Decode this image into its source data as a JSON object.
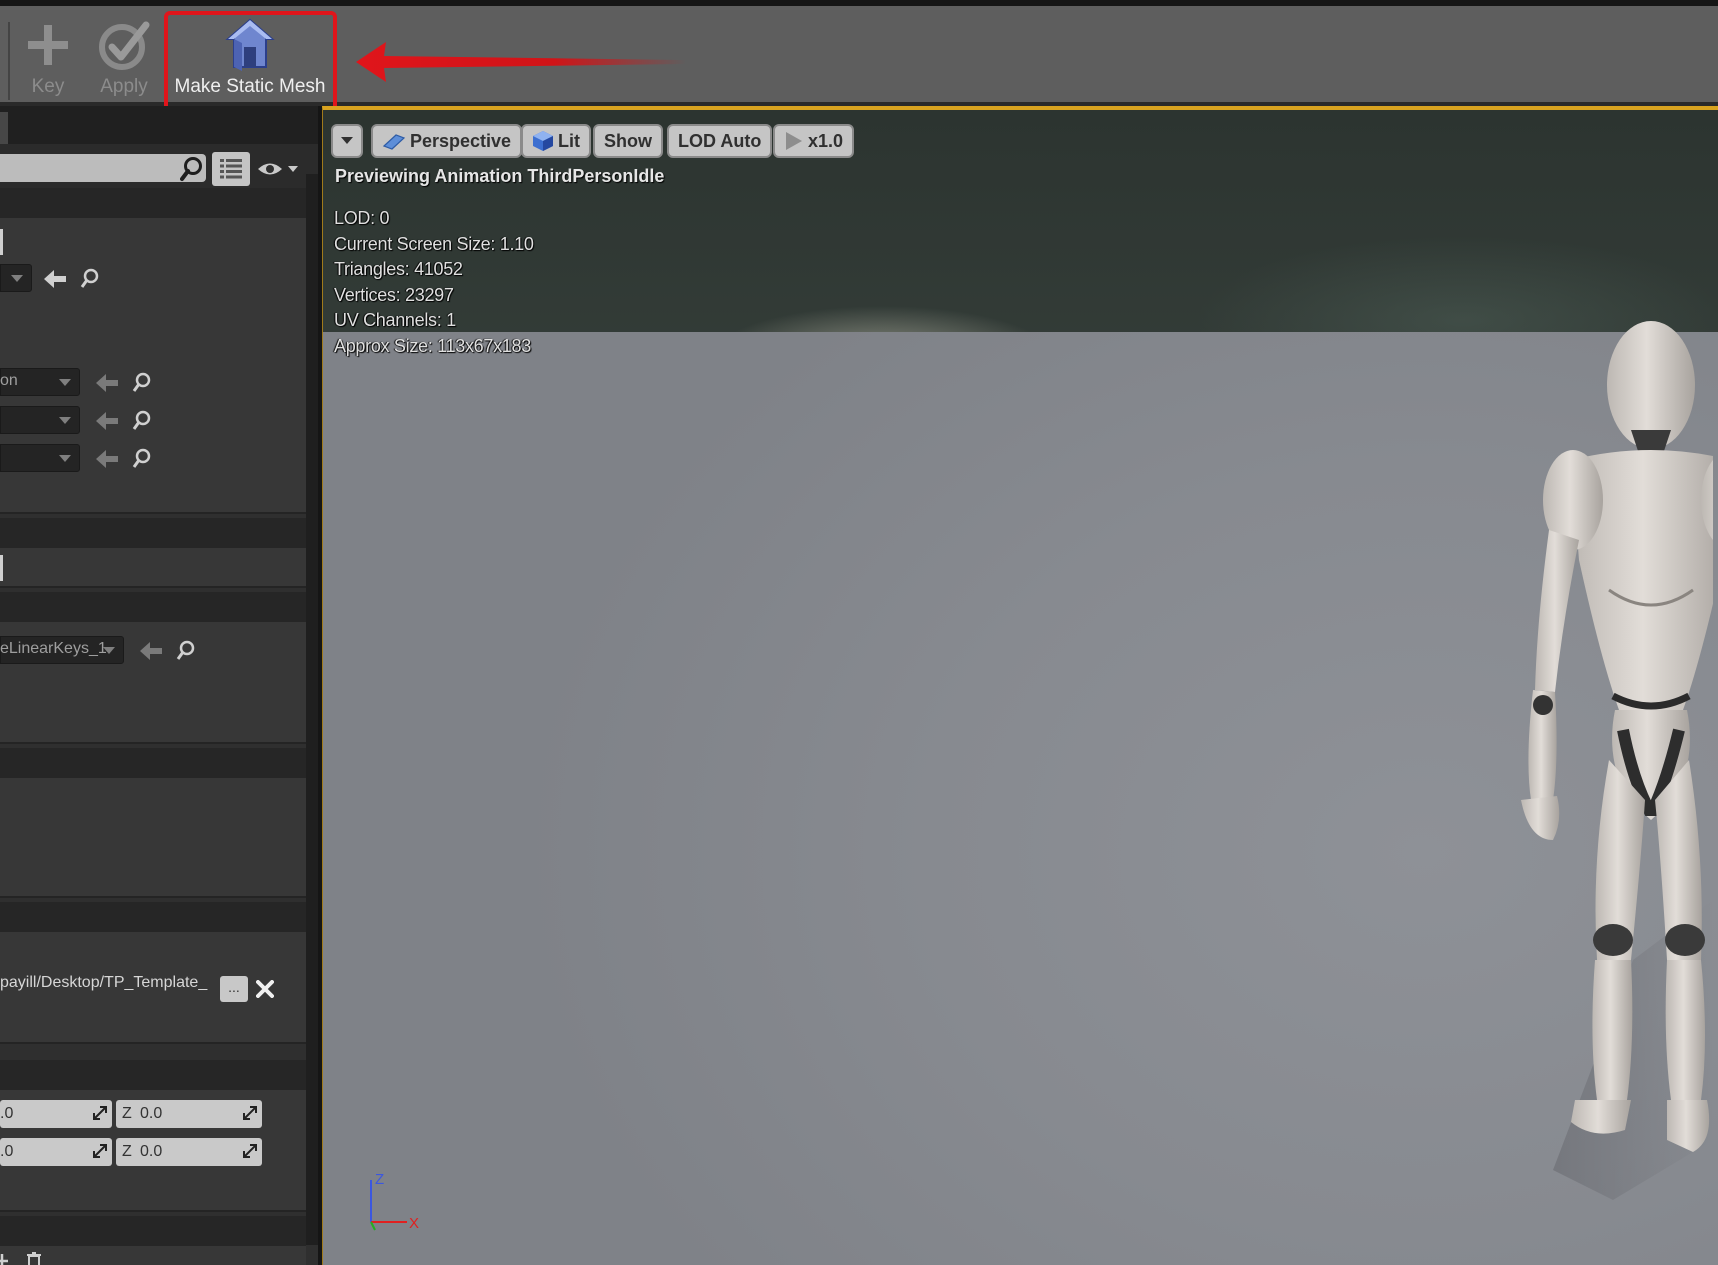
{
  "toolbar": {
    "buttons": [
      {
        "icon": "plus-icon",
        "label": "Key",
        "enabled": false
      },
      {
        "icon": "apply-icon",
        "label": "Apply",
        "enabled": false
      },
      {
        "icon": "static-mesh-icon",
        "label": "Make Static Mesh",
        "enabled": true
      }
    ],
    "highlight_color": "#e0151b",
    "arrow_color": "#e0151b"
  },
  "details_panel": {
    "fields": {
      "anim_truncated": "on",
      "curve_truncated": "eLinearKeys_1",
      "path_truncated": "payill/Desktop/TP_Template_",
      "browse_label": "...",
      "z1_axis": "Z",
      "z1_value": "0.0",
      "z2_axis": "Z",
      "z2_value": "0.0",
      "y1_value": ".0",
      "y2_value": ".0"
    }
  },
  "viewport": {
    "toolbar": {
      "perspective_label": "Perspective",
      "lit_label": "Lit",
      "show_label": "Show",
      "lod_label": "LOD Auto",
      "speed_label": "x1.0"
    },
    "preview_text": "Previewing Animation ThirdPersonIdle",
    "stats": [
      "LOD: 0",
      "Current Screen Size: 1.10",
      "Triangles: 41052",
      "Vertices: 23297",
      "UV Channels: 1",
      "Approx Size: 113x67x183"
    ],
    "gizmo": {
      "z_label": "Z",
      "x_label": "X"
    },
    "accent_color": "#d9a320"
  }
}
